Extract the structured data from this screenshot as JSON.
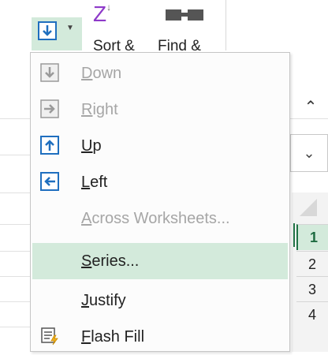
{
  "ribbon": {
    "sort_label": "Sort &",
    "find_label": "Find &"
  },
  "menu": {
    "items": [
      {
        "key": "D",
        "rest": "own",
        "icon": "fill-down-icon",
        "disabled": true
      },
      {
        "key": "R",
        "rest": "ight",
        "icon": "fill-right-icon",
        "disabled": true
      },
      {
        "key": "U",
        "rest": "p",
        "icon": "fill-up-icon",
        "disabled": false
      },
      {
        "key": "L",
        "rest": "eft",
        "icon": "fill-left-icon",
        "disabled": false
      },
      {
        "key": "A",
        "rest": "cross Worksheets...",
        "icon": "",
        "disabled": true
      },
      {
        "key": "S",
        "rest": "eries...",
        "icon": "",
        "disabled": false,
        "highlighted": true
      },
      {
        "key": "J",
        "rest": "ustify",
        "icon": "",
        "disabled": false
      },
      {
        "key": "F",
        "rest": "lash Fill",
        "icon": "flash-fill-icon",
        "disabled": false
      }
    ]
  },
  "row_headers": [
    "1",
    "2",
    "3",
    "4"
  ],
  "colors": {
    "accent_green": "#217346",
    "highlight": "#d3eadb",
    "sort_icon": "#8e3ac9",
    "icon_blue": "#1f6fbf"
  }
}
